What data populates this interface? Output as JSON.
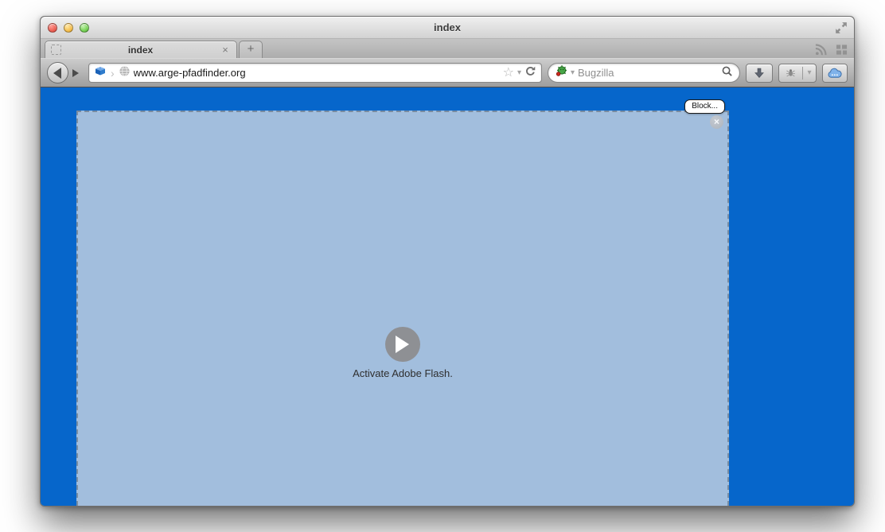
{
  "window": {
    "title": "index"
  },
  "titlebar": {
    "controls": [
      "close",
      "minimize",
      "zoom"
    ]
  },
  "tabbar": {
    "active_tab": {
      "label": "index",
      "close_glyph": "×"
    },
    "new_tab_glyph": "+"
  },
  "navbar": {
    "url": "www.arge-pfadfinder.org",
    "search_placeholder": "Bugzilla",
    "glyphs": {
      "star": "☆",
      "dropdown": "▾",
      "chevron": "›"
    }
  },
  "page": {
    "block_button_label": "Block...",
    "flash_close_glyph": "×",
    "activate_text": "Activate Adobe Flash.",
    "colors": {
      "page_background": "#0666cb",
      "flash_placeholder": "#a2bedd"
    }
  },
  "icons": {
    "titlebar": [
      "fullscreen-icon"
    ],
    "tabbar": [
      "favicon-placeholder-icon",
      "rss-icon",
      "tab-groups-icon"
    ],
    "navbar": [
      "back-icon",
      "forward-icon",
      "plugin-brick-icon",
      "site-globe-icon",
      "bookmark-star-icon",
      "reload-icon",
      "bugzilla-engine-icon",
      "search-magnifier-icon",
      "downloads-icon",
      "addon-bug-icon",
      "cloud-icon"
    ],
    "page": [
      "play-icon",
      "close-icon"
    ]
  }
}
